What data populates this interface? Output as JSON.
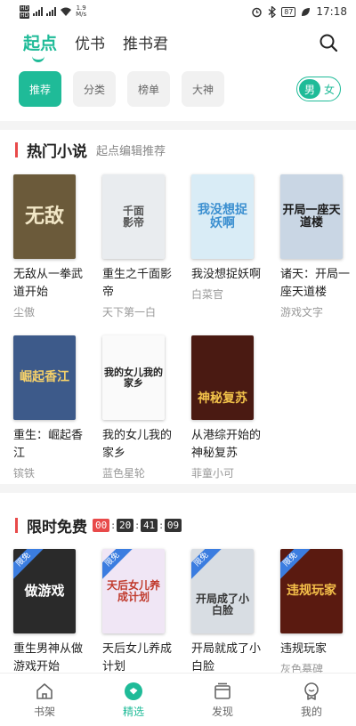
{
  "status_bar": {
    "speed": "1.9",
    "speed_unit": "M/s",
    "battery": "87",
    "time": "17:18"
  },
  "top_tabs": [
    "起点",
    "优书",
    "推书君"
  ],
  "chips": [
    "推荐",
    "分类",
    "榜单",
    "大神"
  ],
  "gender": {
    "selected": "男",
    "other": "女"
  },
  "hot": {
    "title": "热门小说",
    "subtitle": "起点编辑推荐",
    "books": [
      {
        "title": "无敌从一拳武道开始",
        "author": "尘傲",
        "cover_text": "无敌",
        "cover_bg": "#6b5a3a"
      },
      {
        "title": "重生之千面影帝",
        "author": "天下第一白",
        "cover_text": "千面影帝",
        "cover_bg": "#e9ecef"
      },
      {
        "title": "我没想捉妖啊",
        "author": "白菜官",
        "cover_text": "我没想捉妖啊",
        "cover_bg": "#d9ecf6"
      },
      {
        "title": "诸天：开局一座天道楼",
        "author": "游戏文字",
        "cover_text": "开局一座天道楼",
        "cover_bg": "#c9d6e4"
      },
      {
        "title": "重生：崛起香江",
        "author": "镔铁",
        "cover_text": "崛起香江",
        "cover_bg": "#3d5a8a"
      },
      {
        "title": "我的女儿我的家乡",
        "author": "蓝色星轮",
        "cover_text": "我的女儿我的家乡",
        "cover_bg": "#fafafa"
      },
      {
        "title": "从港综开始的神秘复苏",
        "author": "菲童小可",
        "cover_text": "神秘复苏",
        "cover_bg": "#4a1a12"
      }
    ]
  },
  "free": {
    "title": "限时免费",
    "timer": [
      "00",
      "20",
      "41",
      "09"
    ],
    "tag": "限免",
    "books": [
      {
        "title": "重生男神从做游戏开始",
        "author": "",
        "cover_text": "做游戏",
        "cover_bg": "#2a2a2a"
      },
      {
        "title": "天后女儿养成计划",
        "author": "",
        "cover_text": "天后女儿养成计划",
        "cover_bg": "#f0e6f5"
      },
      {
        "title": "开局就成了小白脸",
        "author": "",
        "cover_text": "开局成了小白脸",
        "cover_bg": "#d8dde3"
      },
      {
        "title": "违规玩家",
        "author": "灰色墓碑",
        "cover_text": "违规玩家",
        "cover_bg": "#5a1a10"
      }
    ]
  },
  "bottom_nav": [
    "书架",
    "精选",
    "发现",
    "我的"
  ],
  "colors": {
    "accent": "#1fbb98",
    "section_bar": "#e84a4a",
    "free_tag": "#3b7de0"
  }
}
